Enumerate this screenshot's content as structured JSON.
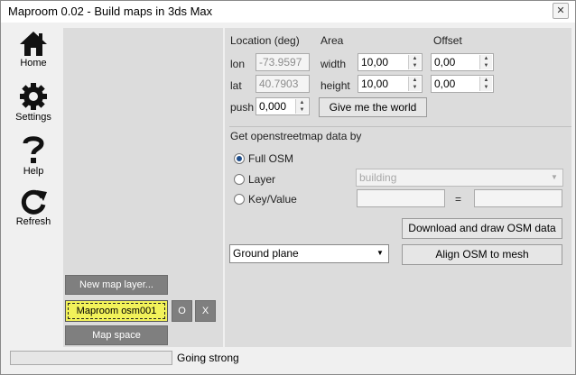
{
  "window": {
    "title": "Maproom 0.02 - Build maps in 3ds Max",
    "close_label": "✕"
  },
  "nav": [
    {
      "label": "Home",
      "icon": "home-icon"
    },
    {
      "label": "Settings",
      "icon": "gear-icon"
    },
    {
      "label": "Help",
      "icon": "question-icon"
    },
    {
      "label": "Refresh",
      "icon": "refresh-icon"
    }
  ],
  "layers": {
    "new_layer_label": "New map layer...",
    "active_layer_label": "Maproom osm001",
    "o_label": "O",
    "x_label": "X",
    "map_space_label": "Map space"
  },
  "location": {
    "heading": "Location (deg)",
    "lon_label": "lon",
    "lon_value": "-73.9597",
    "lat_label": "lat",
    "lat_value": "40.7903",
    "push_label": "push",
    "push_value": "0,000"
  },
  "area": {
    "heading": "Area",
    "width_label": "width",
    "width_value": "10,00",
    "height_label": "height",
    "height_value": "10,00"
  },
  "offset": {
    "heading": "Offset",
    "x_value": "0,00",
    "y_value": "0,00"
  },
  "give_world_label": "Give me the world",
  "osm": {
    "heading": "Get openstreetmap data by",
    "option_full": "Full OSM",
    "option_layer": "Layer",
    "option_keyvalue": "Key/Value",
    "selected": "Full OSM",
    "layer_value": "building",
    "key_value": "",
    "value_value": "",
    "equals": "=",
    "download_label": "Download and draw OSM data",
    "ground_value": "Ground plane",
    "align_label": "Align OSM to mesh"
  },
  "status": {
    "text": "Going strong",
    "progress": 0
  },
  "colors": {
    "active_layer": "#f2f25a",
    "layer_button": "#7f7f7f",
    "panel": "#dcdcdc"
  }
}
